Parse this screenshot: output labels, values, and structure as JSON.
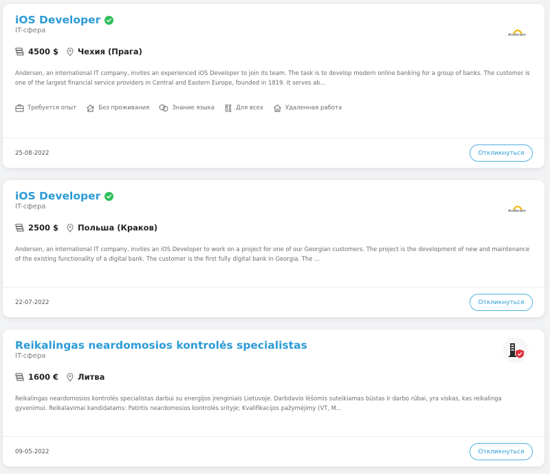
{
  "vacancies": [
    {
      "title": "iOS Developer",
      "category": "IT-сфера",
      "salary": "4500 $",
      "location": "Чехия (Прага)",
      "description": "Andersen, an international IT company, invites an experienced iOS Developer to join its team. The task is to develop modern online banking for a group of banks. The customer is one of the largest financial service providers in Central and Eastern Europe, founded in 1819. It serves ab...",
      "date": "25-08-2022",
      "respond_label": "Откликнуться",
      "logo_text": "Andersen",
      "tags": [
        "Требуется опыт",
        "Без проживания",
        "Знание языка",
        "Для всех",
        "Удаленная работа"
      ]
    },
    {
      "title": "iOS Developer",
      "category": "IT-сфера",
      "salary": "2500 $",
      "location": "Польша (Краков)",
      "description": "Andersen, an international IT company, invites an iOS Developer to work on a project for one of our Georgian customers. The project is the development of new and maintenance of the existing functionality of a digital bank. The customer is the first fully digital bank in Georgia. The ...",
      "date": "22-07-2022",
      "respond_label": "Откликнуться",
      "logo_text": "Andersen"
    },
    {
      "title": "Reikalingas neardomosios kontrolės specialistas",
      "category": "IT-сфера",
      "salary": "1600 €",
      "location": "Литва",
      "description": "Reikalingas neardomosios kontrolės specialistas darbui su energijos įrenginiais Lietuvoje. Darbdavio lėšomis suteikiamas būstas ir darbo rūbai, yra viskas, kas reikalinga gyvenimui. Reikalavimai kandidatams: Patirtis neardomosios kontrolės srityje; Kvalifikacijos pažymėjimy (VT, M...",
      "date": "09-05-2022",
      "respond_label": "Откликнуться"
    }
  ],
  "colors": {
    "accent": "#2c9bd6",
    "verified": "#2fbf5a",
    "logo_yellow": "#f2b705",
    "shield_red": "#e0303a"
  }
}
